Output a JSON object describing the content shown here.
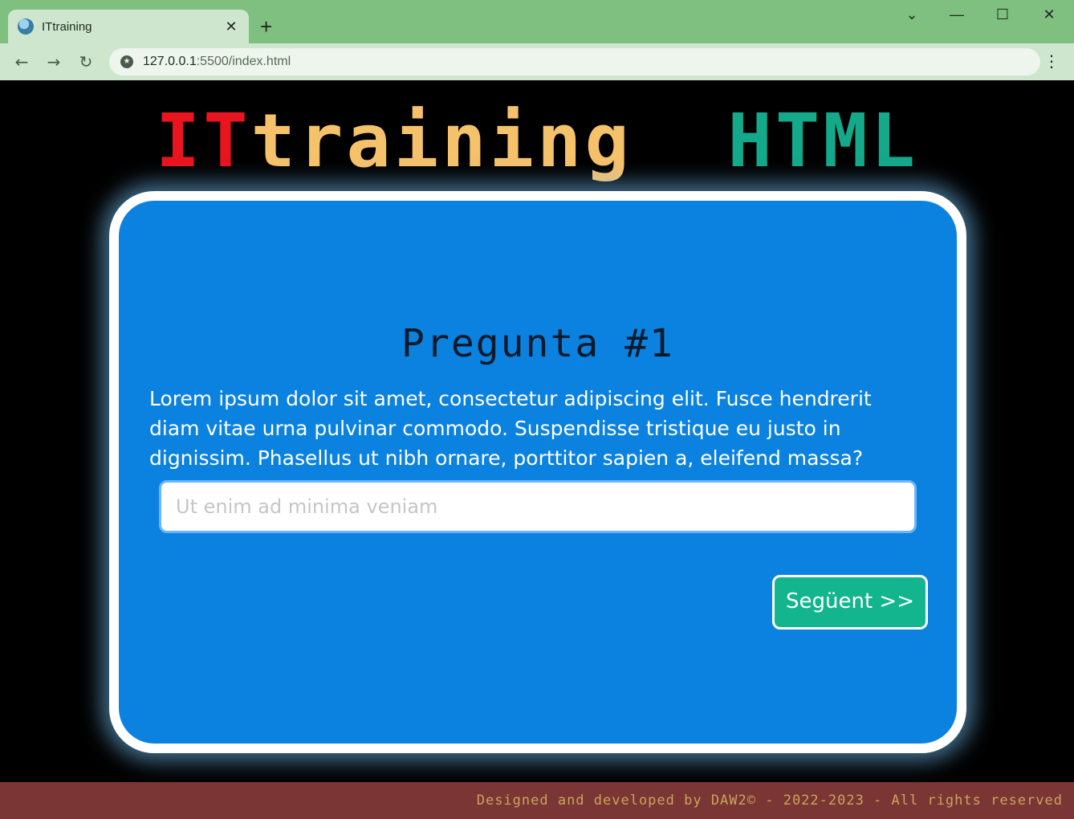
{
  "browser": {
    "tab_title": "ITtraining",
    "new_tab_label": "+",
    "url_host": "127.0.0.1",
    "url_rest": ":5500/index.html",
    "controls": {
      "collapse": "⌄",
      "minimize": "—",
      "maximize": "☐",
      "close": "✕"
    },
    "nav": {
      "back": "←",
      "forward": "→",
      "reload": "↻",
      "menu": "⋮"
    },
    "tab_close": "✕"
  },
  "logo": {
    "part1": "IT",
    "part2": "training",
    "part3": "HTML"
  },
  "question": {
    "title": "Pregunta #1",
    "text": "Lorem ipsum dolor sit amet, consectetur adipiscing elit. Fusce hendrerit diam vitae urna pulvinar commodo. Suspendisse tristique eu justo in dignissim. Phasellus ut nibh ornare, porttitor sapien a, eleifend massa?",
    "answer_placeholder": "Ut enim ad minima veniam",
    "answer_value": ""
  },
  "next_button": {
    "label": "Següent >>"
  },
  "footer": {
    "text": "Designed and developed by DAW2© - 2022-2023 - All rights reserved"
  },
  "colors": {
    "logo_it": "#e8141e",
    "logo_training": "#f5c16b",
    "logo_html": "#13a98a",
    "card_bg": "#0b82e0",
    "button_bg": "#13b58e",
    "footer_bg": "#7a3535",
    "footer_text": "#c9a55a"
  }
}
